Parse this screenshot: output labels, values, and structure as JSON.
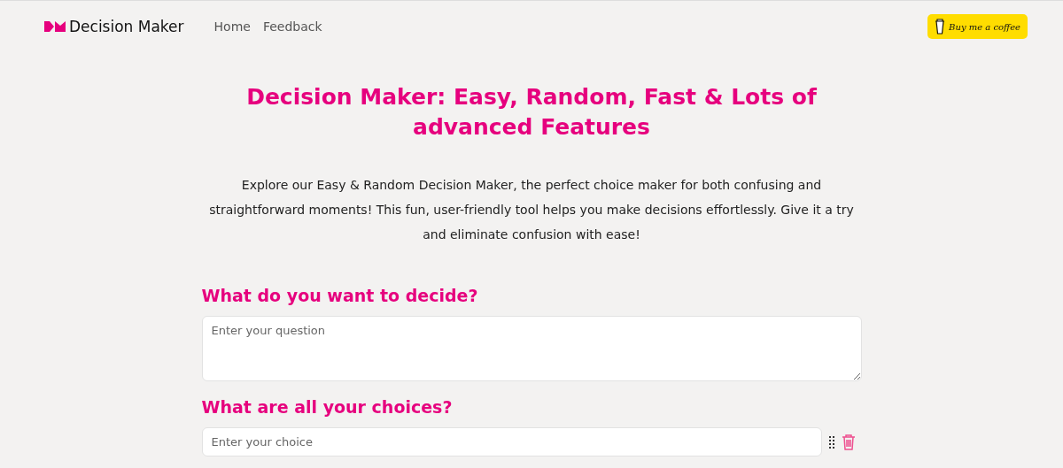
{
  "nav": {
    "brand": "Decision Maker",
    "links": [
      "Home",
      "Feedback"
    ],
    "coffee_button": "Buy me a coffee"
  },
  "title": "Decision Maker: Easy, Random, Fast & Lots of advanced Features",
  "intro": "Explore our Easy & Random Decision Maker, the perfect choice maker for both confusing and straightforward moments! This fun, user-friendly tool helps you make decisions effortlessly. Give it a try and eliminate confusion with ease!",
  "question": {
    "heading": "What do you want to decide?",
    "placeholder": "Enter your question"
  },
  "choices": {
    "heading": "What are all your choices?",
    "items": [
      {
        "placeholder": "Enter your choice"
      }
    ]
  }
}
